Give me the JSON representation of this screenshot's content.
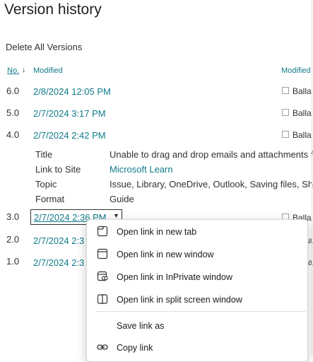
{
  "page": {
    "title": "Version history",
    "delete_all": "Delete All Versions"
  },
  "columns": {
    "no": "No.",
    "sort_icon": "↓",
    "modified": "Modified",
    "modified_by": "Modified"
  },
  "versions": [
    {
      "no": "6.0",
      "date": "2/8/2024 12:05 PM",
      "by": "Balla"
    },
    {
      "no": "5.0",
      "date": "2/7/2024 3:17 PM",
      "by": "Balla"
    },
    {
      "no": "4.0",
      "date": "2/7/2024 2:42 PM",
      "by": "Balla"
    },
    {
      "no": "3.0",
      "date": "2/7/2024 2:36 PM",
      "by": "Balla"
    },
    {
      "no": "2.0",
      "date": "2/7/2024 2:3",
      "by": "a"
    },
    {
      "no": "1.0",
      "date": "2/7/2024 2:3",
      "by": "a"
    }
  ],
  "details": [
    {
      "label": "Title",
      "value": "Unable to drag and drop emails and attachments f"
    },
    {
      "label": "Link to Site",
      "value": "Microsoft Learn"
    },
    {
      "label": "Topic",
      "value": "Issue, Library, OneDrive, Outlook, Saving files, Shar"
    },
    {
      "label": "Format",
      "value": "Guide"
    }
  ],
  "context_menu": {
    "items": [
      {
        "label": "Open link in new tab",
        "icon": "new-tab-icon"
      },
      {
        "label": "Open link in new window",
        "icon": "new-window-icon"
      },
      {
        "label": "Open link in InPrivate window",
        "icon": "inprivate-icon"
      },
      {
        "label": "Open link in split screen window",
        "icon": "split-screen-icon"
      },
      {
        "label": "Save link as",
        "icon": ""
      },
      {
        "label": "Copy link",
        "icon": "link-icon"
      }
    ]
  },
  "colors": {
    "link": "#0f7b8a",
    "text": "#323130"
  }
}
